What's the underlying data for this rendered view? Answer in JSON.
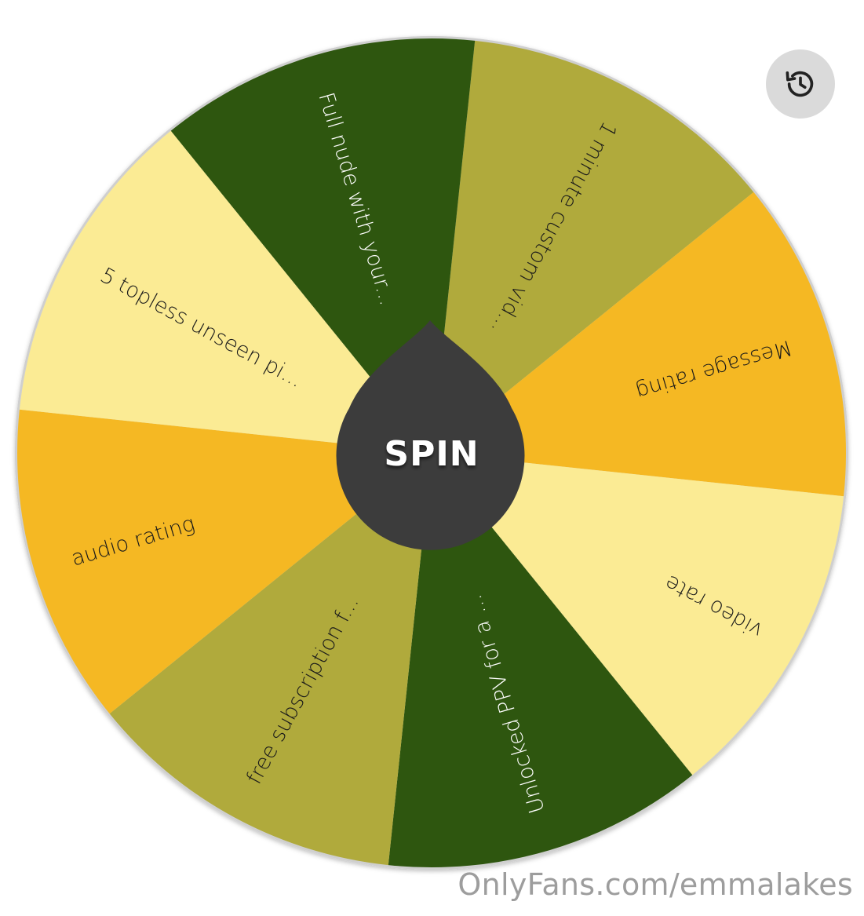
{
  "wheel": {
    "spin_label": "SPIN",
    "pointer_color": "#3c3c3c",
    "segments": [
      {
        "label": "1 minute custom vid...",
        "color": "#b0aa3c",
        "text_color": "#1a1a1a"
      },
      {
        "label": "Message rating",
        "color": "#f5b823",
        "text_color": "#1a1a1a"
      },
      {
        "label": "video rate",
        "color": "#fbeb94",
        "text_color": "#1a1a1a"
      },
      {
        "label": "Unlocked PPV for a ...",
        "color": "#2e560f",
        "text_color": "#ffffff"
      },
      {
        "label": "free subscription f...",
        "color": "#b0aa3c",
        "text_color": "#1a1a1a"
      },
      {
        "label": "audio rating",
        "color": "#f5b823",
        "text_color": "#1a1a1a"
      },
      {
        "label": "5 topless unseen pi...",
        "color": "#fbeb94",
        "text_color": "#1a1a1a"
      },
      {
        "label": "Full nude with your...",
        "color": "#2e560f",
        "text_color": "#ffffff"
      }
    ]
  },
  "history": {
    "icon": "history-icon"
  },
  "watermark": {
    "text": "OnlyFans.com/emmalakes"
  }
}
